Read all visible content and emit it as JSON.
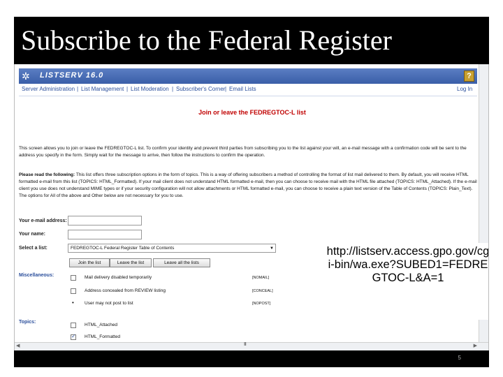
{
  "slide": {
    "title": "Subscribe to the Federal Register",
    "url_callout": "http://listserv.access.gpo.gov/cgi-bin/wa.exe?SUBED1=FEDREGTOC-L&A=1",
    "page_number": "5"
  },
  "listserv": {
    "product_title": "LISTSERV 16.0",
    "help_label": "?",
    "menu": [
      {
        "label": "Server Administration"
      },
      {
        "label": "List Management"
      },
      {
        "label": "List Moderation"
      },
      {
        "label": "Subscriber's Corner"
      },
      {
        "label": "Email Lists"
      }
    ],
    "login_label": "Log In",
    "heading": "Join or leave the FEDREGTOC-L list",
    "intro_text": "This screen allows you to join or leave the FEDREGTOC-L list. To confirm your identity and prevent third parties from subscribing you to the list against your will, an e-mail message with a confirmation code will be sent to the address you specify in the form. Simply wait for the message to arrive, then follow the instructions to confirm the operation.",
    "format_text_lead": "Please read the following:",
    "format_text": " This list offers three subscription options in the form of topics. This is a way of offering subscribers a method of controlling the format of list mail delivered to them. By default, you will receive HTML formatted e-mail from this list (TOPICS: HTML_Formatted). If your mail client does not understand HTML formatted e-mail, then you can choose to receive mail with the HTML file attached (TOPICS: HTML_Attached). If the e-mail client you use does not understand MIME types or if your security configuration will not allow attachments or HTML formatted e-mail, you can choose to receive a plain text version of the Table of Contents (TOPICS: Plain_Text). The options for All of the above and Other below are not necessary for you to use.",
    "form": {
      "email_label": "Your e-mail address:",
      "email_value": "",
      "name_label": "Your name:",
      "name_value": "",
      "select_label": "Select a list:",
      "select_value": "FEDREGTOC-L Federal Register Table of Contents",
      "join_button": "Join the list",
      "leave_button": "Leave the list",
      "leave_all_button": "Leave all the lists"
    },
    "misc_label": "Miscellaneous:",
    "misc_options": [
      {
        "label": "Mail delivery disabled temporarily",
        "code": "[NOMAIL]",
        "type": "checkbox"
      },
      {
        "label": "Address concealed from REVIEW listing",
        "code": "[CONCEAL]",
        "type": "checkbox"
      },
      {
        "label": "User may not post to list",
        "code": "[NOPOST]",
        "type": "bullet"
      }
    ],
    "topics_label": "Topics:",
    "topics": [
      {
        "label": "HTML_Attached",
        "checked": false
      },
      {
        "label": "HTML_Formatted",
        "checked": true
      }
    ]
  }
}
